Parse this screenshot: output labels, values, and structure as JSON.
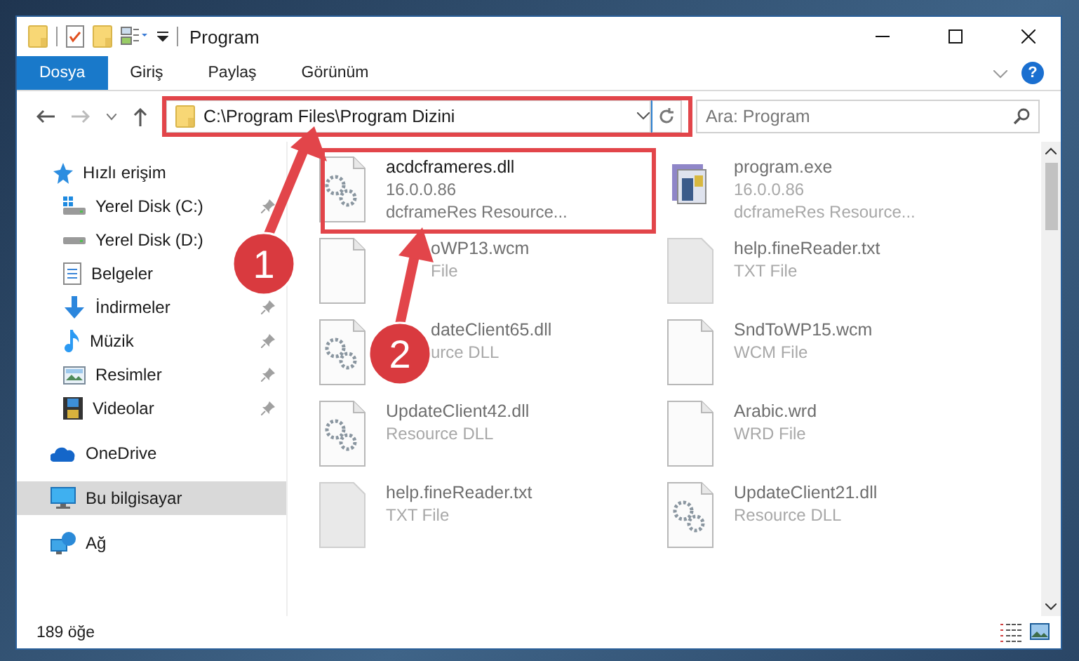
{
  "window": {
    "title": "Program"
  },
  "ribbon": {
    "tabs": [
      {
        "label": "Dosya",
        "selected": true
      },
      {
        "label": "Giriş",
        "selected": false
      },
      {
        "label": "Paylaş",
        "selected": false
      },
      {
        "label": "Görünüm",
        "selected": false
      }
    ],
    "help": "?"
  },
  "address": {
    "path": "C:\\Program Files\\Program Dizini"
  },
  "search": {
    "placeholder": "Ara: Program"
  },
  "sidebar": {
    "items": [
      {
        "label": "Hızlı erişim",
        "kind": "quick-access",
        "selected": false,
        "children": [
          {
            "label": "Yerel Disk (C:)",
            "kind": "system-drive",
            "pinned": true
          },
          {
            "label": "Yerel Disk (D:)",
            "kind": "drive"
          },
          {
            "label": "Belgeler",
            "kind": "documents"
          },
          {
            "label": "İndirmeler",
            "kind": "downloads",
            "pinned": true
          },
          {
            "label": "Müzik",
            "kind": "music",
            "pinned": true
          },
          {
            "label": "Resimler",
            "kind": "pictures",
            "pinned": true
          },
          {
            "label": "Videolar",
            "kind": "videos",
            "pinned": true
          }
        ]
      },
      {
        "label": "OneDrive",
        "kind": "cloud",
        "selected": false
      },
      {
        "label": "Bu bilgisayar",
        "kind": "computer",
        "selected": true
      },
      {
        "label": "Ağ",
        "kind": "network",
        "selected": false
      }
    ]
  },
  "files": [
    {
      "name": "acdcframeres.dll",
      "kind": "library",
      "faded": false,
      "lines": [
        "16.0.0.86",
        "dcframeRes Resource..."
      ]
    },
    {
      "name": "program.exe",
      "kind": "program",
      "faded": true,
      "lines": [
        "16.0.0.86",
        "dcframeRes Resource..."
      ]
    },
    {
      "name": "oWP13.wcm",
      "kind": "document",
      "faded": true,
      "partly_hidden": true,
      "lines": [
        "File"
      ]
    },
    {
      "name": "help.fineReader.txt",
      "kind": "text",
      "faded": true,
      "lines": [
        "TXT File"
      ]
    },
    {
      "name": "dateClient65.dll",
      "kind": "library",
      "faded": true,
      "partly_hidden": true,
      "lines": [
        "urce DLL"
      ]
    },
    {
      "name": "SndToWP15.wcm",
      "kind": "document",
      "faded": true,
      "lines": [
        "WCM File"
      ]
    },
    {
      "name": "UpdateClient42.dll",
      "kind": "library",
      "faded": true,
      "lines": [
        "Resource DLL"
      ]
    },
    {
      "name": "Arabic.wrd",
      "kind": "document",
      "faded": true,
      "lines": [
        "WRD File"
      ]
    },
    {
      "name": "help.fineReader.txt",
      "kind": "text",
      "faded": true,
      "lines": [
        "TXT File"
      ]
    },
    {
      "name": "UpdateClient21.dll",
      "kind": "library",
      "faded": true,
      "lines": [
        "Resource DLL"
      ]
    }
  ],
  "status_bar": {
    "count": "189 öğe"
  },
  "annotations": [
    {
      "label": "1"
    },
    {
      "label": "2"
    }
  ]
}
